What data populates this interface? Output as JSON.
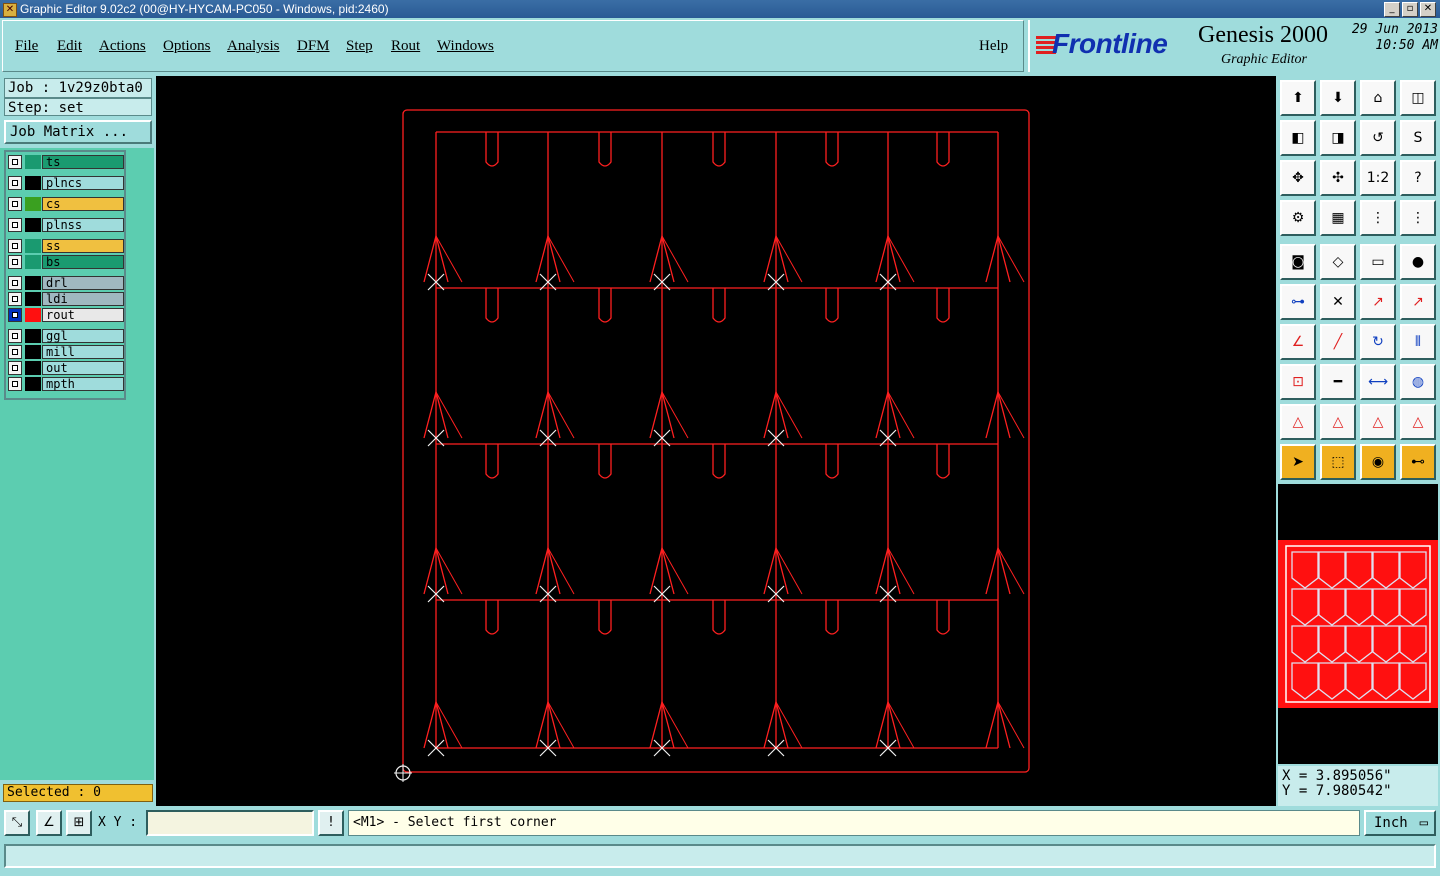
{
  "window": {
    "title": "Graphic Editor 9.02c2 (00@HY-HYCAM-PC050 - Windows, pid:2460)",
    "controls": [
      "_",
      "▫",
      "✕"
    ]
  },
  "menu": {
    "items": [
      "File",
      "Edit",
      "Actions",
      "Options",
      "Analysis",
      "DFM",
      "Step",
      "Rout",
      "Windows"
    ],
    "help": "Help"
  },
  "logo": {
    "brand": "Frontline",
    "product": "Genesis 2000",
    "subtitle": "Graphic Editor",
    "date": "29 Jun 2013",
    "time": "10:50 AM"
  },
  "job": {
    "job_label": "Job : 1v29z0bta0",
    "step_label": "Step: set",
    "matrix_button": "Job Matrix ..."
  },
  "layers": [
    {
      "name": "ts",
      "color": "#1a9a70",
      "swatch": "#1a9a70"
    },
    {
      "name": "plncs",
      "color": "#9fdcdc",
      "swatch": "#000000"
    },
    {
      "name": "cs",
      "color": "#f0c040",
      "swatch": "#3aa020"
    },
    {
      "name": "plnss",
      "color": "#9fdcdc",
      "swatch": "#000000"
    },
    {
      "name": "ss",
      "color": "#f0c040",
      "swatch": "#1a9a70"
    },
    {
      "name": "bs",
      "color": "#1a9a70",
      "swatch": "#1a9a70"
    },
    {
      "name": "drl",
      "color": "#a0b8c0",
      "swatch": "#000000"
    },
    {
      "name": "ldi",
      "color": "#a0b8c0",
      "swatch": "#000000"
    },
    {
      "name": "rout",
      "color": "#e8e8e8",
      "swatch": "#ff1010",
      "active": true
    },
    {
      "name": "ggl",
      "color": "#9fdcdc",
      "swatch": "#000000"
    },
    {
      "name": "mill",
      "color": "#9fdcdc",
      "swatch": "#000000"
    },
    {
      "name": "out",
      "color": "#9fdcdc",
      "swatch": "#000000"
    },
    {
      "name": "mpth",
      "color": "#9fdcdc",
      "swatch": "#000000"
    }
  ],
  "selected": "Selected : 0",
  "toolbar_icons": [
    "open-layer-icon",
    "save-layer-icon",
    "home-icon",
    "panel-icon",
    "in-icon",
    "out-icon",
    "undo-arrow-icon",
    "step-icon",
    "zoom-fit-icon",
    "zoom-extents-icon",
    "scale-1-2-icon",
    "help-icon",
    "settings-icon",
    "grid-icon",
    "snap-a-icon",
    "snap-b-icon",
    "pad-icon",
    "line-icon",
    "ruler-icon",
    "circle-icon",
    "nodes-icon",
    "cross-icon",
    "arrow-red-icon",
    "arrow-blue-icon",
    "angle-icon",
    "diag-icon",
    "arc-icon",
    "ff-icon",
    "point-icon",
    "minus-icon",
    "measure-icon",
    "shapes-icon",
    "tri-a-icon",
    "tri-b-icon",
    "tri-c-icon",
    "tri-d-icon",
    "pointer-icon",
    "pointer-box-icon",
    "pointer-circle-icon",
    "pointer-net-icon"
  ],
  "coords": {
    "x": "X = 3.895056\"",
    "y": "Y = 7.980542\""
  },
  "bottom": {
    "xy_label": "X Y :",
    "xy_value": "",
    "bang": "!",
    "prompt": "<M1> - Select first corner",
    "unit": "Inch"
  },
  "colors": {
    "accent": "#9fdcdc",
    "rout": "#ff1010",
    "panel": "#5ccdb0"
  }
}
